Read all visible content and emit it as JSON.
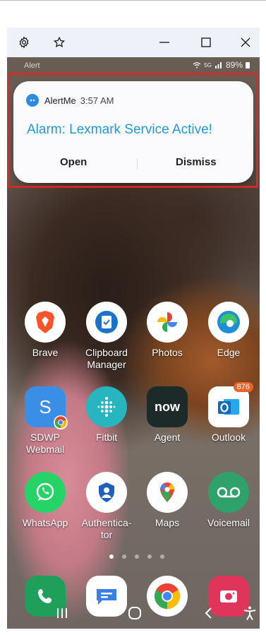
{
  "window": {
    "settings_icon": "gear-icon",
    "pin_icon": "star-icon",
    "minimize_icon": "minimize-icon",
    "maximize_icon": "maximize-icon",
    "close_icon": "close-icon"
  },
  "status_bar": {
    "left_text": "Alert",
    "network": "5G",
    "battery": "89%"
  },
  "notification": {
    "app_name": "AlertMe",
    "time": "3:57 AM",
    "title": "Alarm: Lexmark Service Active!",
    "open_label": "Open",
    "dismiss_label": "Dismiss",
    "title_color": "#1e9ad6",
    "highlight_color": "#d32a2a"
  },
  "apps": [
    {
      "label": "Brave",
      "icon": "brave-icon"
    },
    {
      "label": "Clipboard\nManager",
      "icon": "clipboard-icon"
    },
    {
      "label": "Photos",
      "icon": "photos-icon"
    },
    {
      "label": "Edge",
      "icon": "edge-icon"
    },
    {
      "label": "SDWP\nWebmail",
      "icon": "webmail-icon"
    },
    {
      "label": "Fitbit",
      "icon": "fitbit-icon"
    },
    {
      "label": "Agent",
      "icon": "now-icon",
      "icon_text": "now"
    },
    {
      "label": "Outlook",
      "icon": "outlook-icon",
      "badge": "876"
    },
    {
      "label": "WhatsApp",
      "icon": "whatsapp-icon"
    },
    {
      "label": "Authentica-\ntor",
      "icon": "authenticator-icon"
    },
    {
      "label": "Maps",
      "icon": "maps-icon"
    },
    {
      "label": "Voicemail",
      "icon": "voicemail-icon"
    }
  ],
  "page_indicator": {
    "count": 5,
    "active_index": 0
  },
  "dock": [
    {
      "icon": "phone-icon"
    },
    {
      "icon": "messages-icon"
    },
    {
      "icon": "chrome-icon"
    },
    {
      "icon": "camera-icon"
    }
  ],
  "nav_bar": {
    "recents_icon": "recents-icon",
    "home_icon": "home-icon",
    "back_icon": "back-icon",
    "accessibility_icon": "accessibility-icon"
  }
}
